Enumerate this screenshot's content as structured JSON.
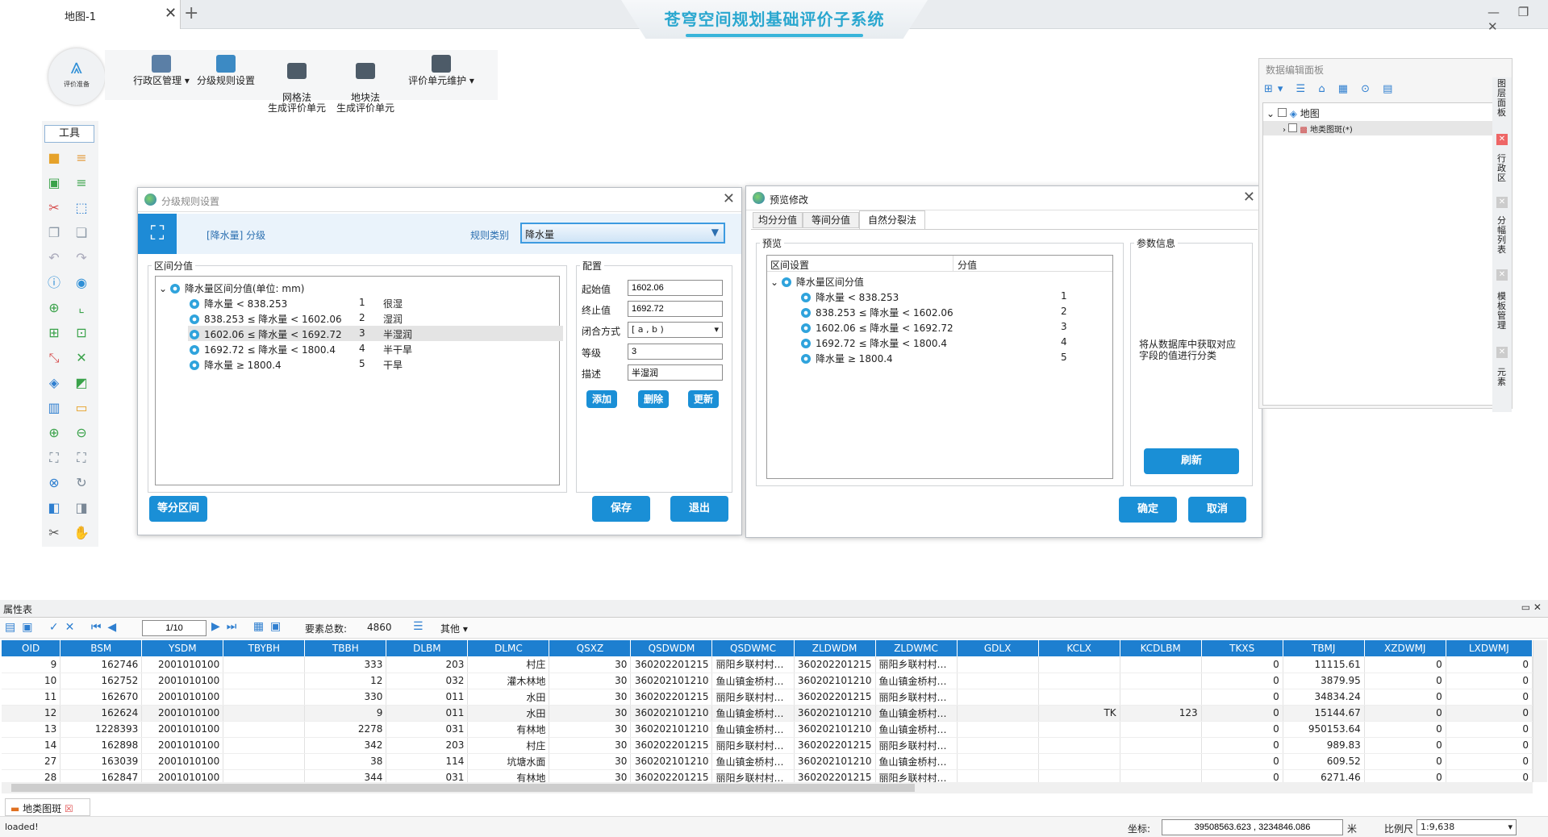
{
  "tabs": {
    "map_tab": "地图-1",
    "add": "+"
  },
  "app_title": "苍穹空间规划基础评价子系统",
  "window_controls": "— ❐ ✕",
  "round_button": {
    "label": "评价准备"
  },
  "ribbon": [
    {
      "label": "行政区管理",
      "dropdown": true
    },
    {
      "label": "分级规则设置",
      "dropdown": false
    },
    {
      "label": "网格法\n生成评价单元",
      "dropdown": false
    },
    {
      "label": "地块法\n生成评价单元",
      "dropdown": false
    },
    {
      "label": "评价单元维护",
      "dropdown": true
    }
  ],
  "tools": {
    "header": "工具"
  },
  "rule_dialog": {
    "title": "分级规则设置",
    "heading": "[降水量] 分级",
    "rule_type_label": "规则类别",
    "rule_type_value": "降水量",
    "range_group": "区间分值",
    "tree_root": "降水量区间分值(单位: mm)",
    "rows": [
      {
        "range": "降水量 < 838.253",
        "level": "1",
        "desc": "很湿"
      },
      {
        "range": "838.253 ≤ 降水量 < 1602.06",
        "level": "2",
        "desc": "湿润"
      },
      {
        "range": "1602.06 ≤ 降水量 < 1692.72",
        "level": "3",
        "desc": "半湿润"
      },
      {
        "range": "1692.72 ≤ 降水量 < 1800.4",
        "level": "4",
        "desc": "半干旱"
      },
      {
        "range": "降水量 ≥ 1800.4",
        "level": "5",
        "desc": "干旱"
      }
    ],
    "config_group": "配置",
    "start_label": "起始值",
    "start_value": "1602.06",
    "end_label": "终止值",
    "end_value": "1692.72",
    "closure_label": "闭合方式",
    "closure_value": "[ a , b )",
    "level_label": "等级",
    "level_value": "3",
    "desc_label": "描述",
    "desc_value": "半湿润",
    "btn_add": "添加",
    "btn_delete": "删除",
    "btn_update": "更新",
    "btn_equal": "等分区间",
    "btn_save": "保存",
    "btn_exit": "退出"
  },
  "preview_dialog": {
    "title": "预览修改",
    "tabs": [
      "均分分值",
      "等间分值",
      "自然分裂法"
    ],
    "preview_group": "预览",
    "col_interval": "区间设置",
    "col_score": "分值",
    "tree_root": "降水量区间分值",
    "rows": [
      {
        "range": "降水量 < 838.253",
        "score": "1"
      },
      {
        "range": "838.253 ≤ 降水量 < 1602.06",
        "score": "2"
      },
      {
        "range": "1602.06 ≤ 降水量 < 1692.72",
        "score": "3"
      },
      {
        "range": "1692.72 ≤ 降水量 < 1800.4",
        "score": "4"
      },
      {
        "range": "降水量 ≥ 1800.4",
        "score": "5"
      }
    ],
    "param_group": "参数信息",
    "param_text": "将从数据库中获取对应字段的值进行分类",
    "btn_refresh": "刷新",
    "btn_ok": "确定",
    "btn_cancel": "取消"
  },
  "data_panel": {
    "title": "数据编辑面板",
    "tree_map": "地图",
    "tree_layer": "地类图斑(*)",
    "side_tabs": [
      "图层面板",
      "行政区",
      "分幅列表",
      "模板管理",
      "元素"
    ]
  },
  "attribute_table": {
    "title": "属性表",
    "page": "1/10",
    "total_label": "要素总数:",
    "total_value": "4860",
    "other": "其他",
    "columns": [
      "OID",
      "BSM",
      "YSDM",
      "TBYBH",
      "TBBH",
      "DLBM",
      "DLMC",
      "QSXZ",
      "QSDWDM",
      "QSDWMC",
      "ZLDWDM",
      "ZLDWMC",
      "GDLX",
      "KCLX",
      "KCDLBM",
      "TKXS",
      "TBMJ",
      "XZDWMJ",
      "LXDWMJ"
    ],
    "rows": [
      [
        "9",
        "162746",
        "2001010100",
        "",
        "333",
        "203",
        "村庄",
        "30",
        "360202201215",
        "丽阳乡联村村…",
        "360202201215",
        "丽阳乡联村村…",
        "",
        "",
        "",
        "0",
        "11115.61",
        "0",
        "0"
      ],
      [
        "10",
        "162752",
        "2001010100",
        "",
        "12",
        "032",
        "灌木林地",
        "30",
        "360202101210",
        "鱼山镇金桥村…",
        "360202101210",
        "鱼山镇金桥村…",
        "",
        "",
        "",
        "0",
        "3879.95",
        "0",
        "0"
      ],
      [
        "11",
        "162670",
        "2001010100",
        "",
        "330",
        "011",
        "水田",
        "30",
        "360202201215",
        "丽阳乡联村村…",
        "360202201215",
        "丽阳乡联村村…",
        "",
        "",
        "",
        "0",
        "34834.24",
        "0",
        "0"
      ],
      [
        "12",
        "162624",
        "2001010100",
        "",
        "9",
        "011",
        "水田",
        "30",
        "360202101210",
        "鱼山镇金桥村…",
        "360202101210",
        "鱼山镇金桥村…",
        "",
        "TK",
        "123",
        "0",
        "15144.67",
        "0",
        "0"
      ],
      [
        "13",
        "1228393",
        "2001010100",
        "",
        "2278",
        "031",
        "有林地",
        "30",
        "360202101210",
        "鱼山镇金桥村…",
        "360202101210",
        "鱼山镇金桥村…",
        "",
        "",
        "",
        "0",
        "950153.64",
        "0",
        "0"
      ],
      [
        "14",
        "162898",
        "2001010100",
        "",
        "342",
        "203",
        "村庄",
        "30",
        "360202201215",
        "丽阳乡联村村…",
        "360202201215",
        "丽阳乡联村村…",
        "",
        "",
        "",
        "0",
        "989.83",
        "0",
        "0"
      ],
      [
        "27",
        "163039",
        "2001010100",
        "",
        "38",
        "114",
        "坑塘水面",
        "30",
        "360202101210",
        "鱼山镇金桥村…",
        "360202101210",
        "鱼山镇金桥村…",
        "",
        "",
        "",
        "0",
        "609.52",
        "0",
        "0"
      ],
      [
        "28",
        "162847",
        "2001010100",
        "",
        "344",
        "031",
        "有林地",
        "30",
        "360202201215",
        "丽阳乡联村村…",
        "360202201215",
        "丽阳乡联村村…",
        "",
        "",
        "",
        "0",
        "6271.46",
        "0",
        "0"
      ]
    ],
    "bottom_tab": "地类图斑"
  },
  "status": {
    "text": "loaded!",
    "coord_label": "坐标:",
    "coord_value": "39508563.623 , 3234846.086",
    "unit": "米",
    "scale_label": "比例尺",
    "scale_value": "1:9,638"
  },
  "colors": {
    "accent": "#1a8fd6",
    "header_blue": "#1d7fd0",
    "title": "#2aa7cf"
  }
}
